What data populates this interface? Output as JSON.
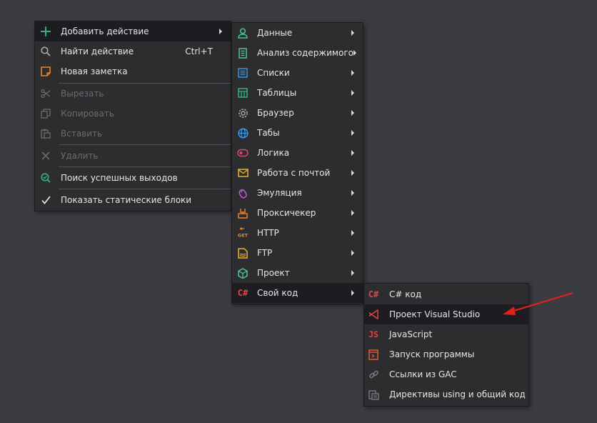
{
  "main_menu": {
    "add_action": "Добавить действие",
    "find_action": "Найти действие",
    "find_shortcut": "Ctrl+T",
    "new_note": "Новая заметка",
    "cut": "Вырезать",
    "copy": "Копировать",
    "paste": "Вставить",
    "delete": "Удалить",
    "find_success_outputs": "Поиск успешных выходов",
    "show_static_blocks": "Показать статические блоки"
  },
  "action_menu": {
    "items": [
      {
        "label": "Данные",
        "icon": "person-icon"
      },
      {
        "label": "Анализ содержимого",
        "icon": "document-icon"
      },
      {
        "label": "Списки",
        "icon": "list-icon"
      },
      {
        "label": "Таблицы",
        "icon": "table-icon"
      },
      {
        "label": "Браузер",
        "icon": "gear-icon"
      },
      {
        "label": "Табы",
        "icon": "globe-icon"
      },
      {
        "label": "Логика",
        "icon": "logic-icon"
      },
      {
        "label": "Работа с почтой",
        "icon": "mail-icon"
      },
      {
        "label": "Эмуляция",
        "icon": "mouse-icon"
      },
      {
        "label": "Проксичекер",
        "icon": "proxy-icon"
      },
      {
        "label": "HTTP",
        "icon": "http-get-icon",
        "icon_text": "GET"
      },
      {
        "label": "FTP",
        "icon": "ftp-icon"
      },
      {
        "label": "Проект",
        "icon": "cube-icon"
      },
      {
        "label": "Свой код",
        "icon": "csharp-icon",
        "icon_text": "C#"
      }
    ]
  },
  "code_menu": {
    "items": [
      {
        "label": "C# код",
        "icon": "csharp-icon",
        "icon_text": "C#"
      },
      {
        "label": "Проект Visual Studio",
        "icon": "visual-studio-icon"
      },
      {
        "label": "JavaScript",
        "icon": "javascript-icon",
        "icon_text": "JS"
      },
      {
        "label": "Запуск программы",
        "icon": "run-program-icon"
      },
      {
        "label": "Ссылки из GAC",
        "icon": "link-icon"
      },
      {
        "label": "Директивы using и общий код",
        "icon": "directives-icon"
      }
    ]
  },
  "colors": {
    "background": "#3b3b42",
    "menu": "#2d2d30",
    "highlight": "#1d1d21",
    "annotation_arrow": "#e0201c"
  }
}
